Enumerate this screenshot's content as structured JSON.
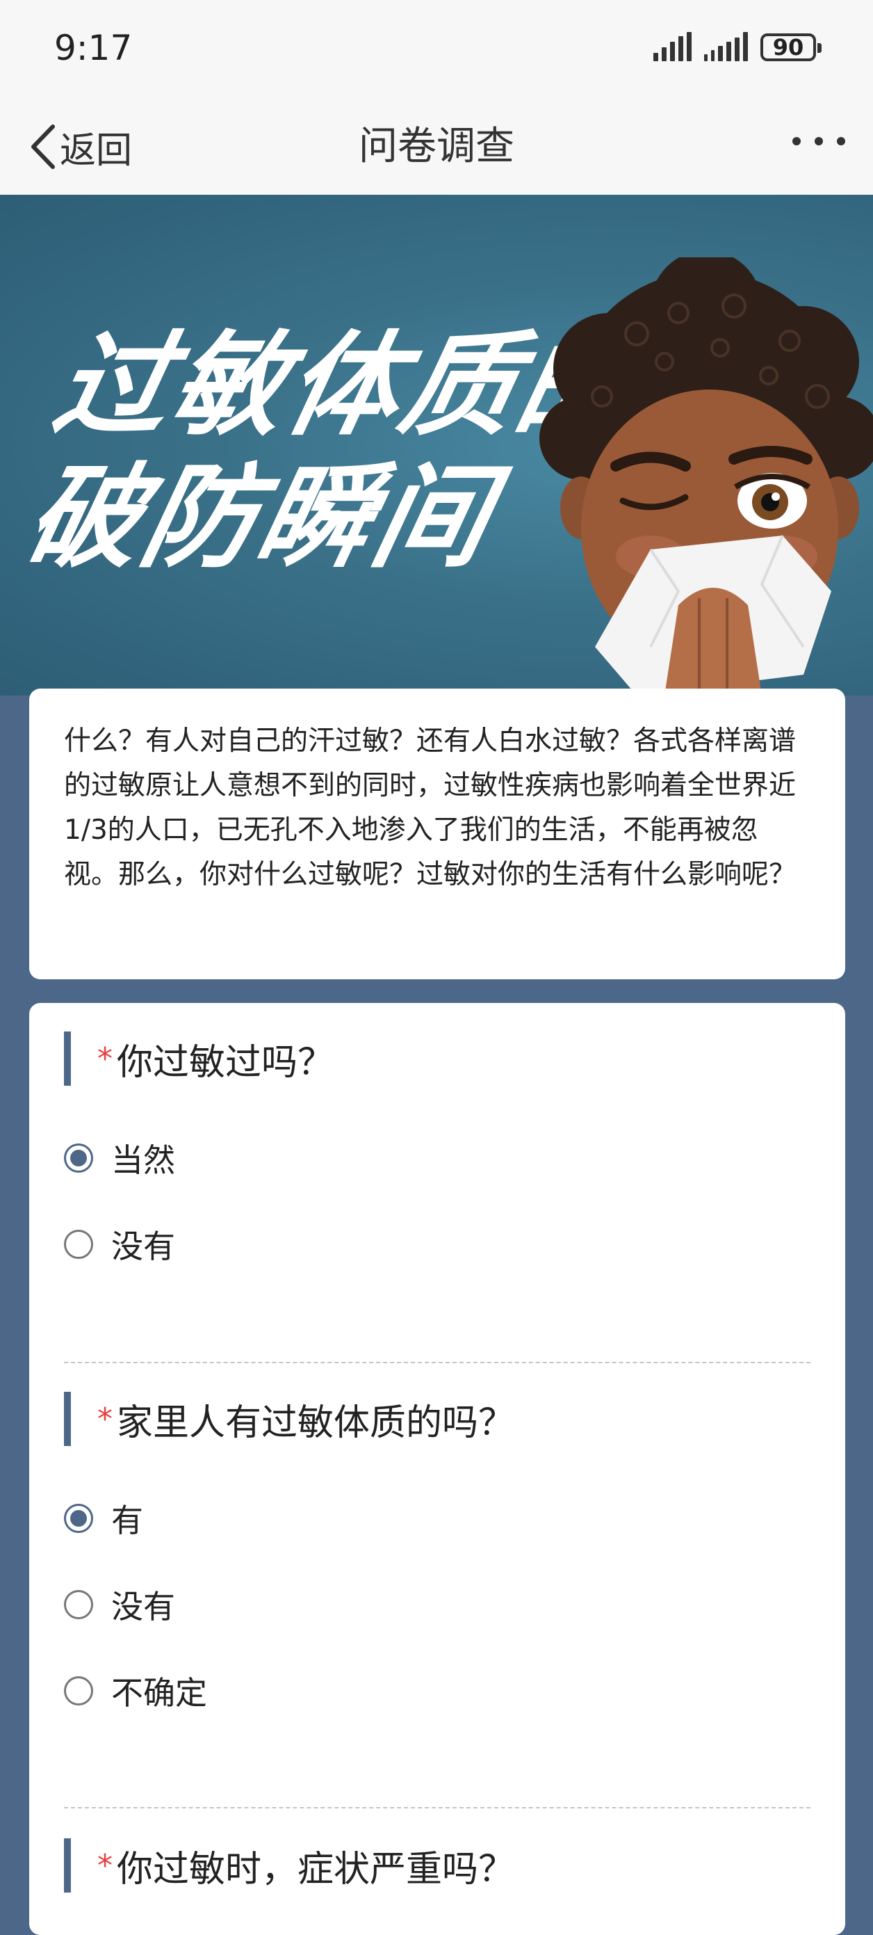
{
  "status": {
    "time": "9:17",
    "battery": "90"
  },
  "nav": {
    "back_label": "返回",
    "title": "问卷调查"
  },
  "banner": {
    "title_line1": "过敏体质的",
    "title_line2": "破防瞬间"
  },
  "intro": "什么？有人对自己的汗过敏？还有人白水过敏？各式各样离谱的过敏原让人意想不到的同时，过敏性疾病也影响着全世界近1/3的人口，已无孔不入地渗入了我们的生活，不能再被忽视。那么，你对什么过敏呢？过敏对你的生活有什么影响呢？",
  "questions": [
    {
      "required": "*",
      "text": "你过敏过吗？",
      "options": [
        {
          "label": "当然",
          "selected": true
        },
        {
          "label": "没有",
          "selected": false
        }
      ]
    },
    {
      "required": "*",
      "text": "家里人有过敏体质的吗？",
      "options": [
        {
          "label": "有",
          "selected": true
        },
        {
          "label": "没有",
          "selected": false
        },
        {
          "label": "不确定",
          "selected": false
        }
      ]
    },
    {
      "required": "*",
      "text": "你过敏时，症状严重吗？",
      "options": []
    }
  ],
  "colors": {
    "accent": "#4d6789",
    "required": "#e74040",
    "banner": "#3a7189"
  }
}
